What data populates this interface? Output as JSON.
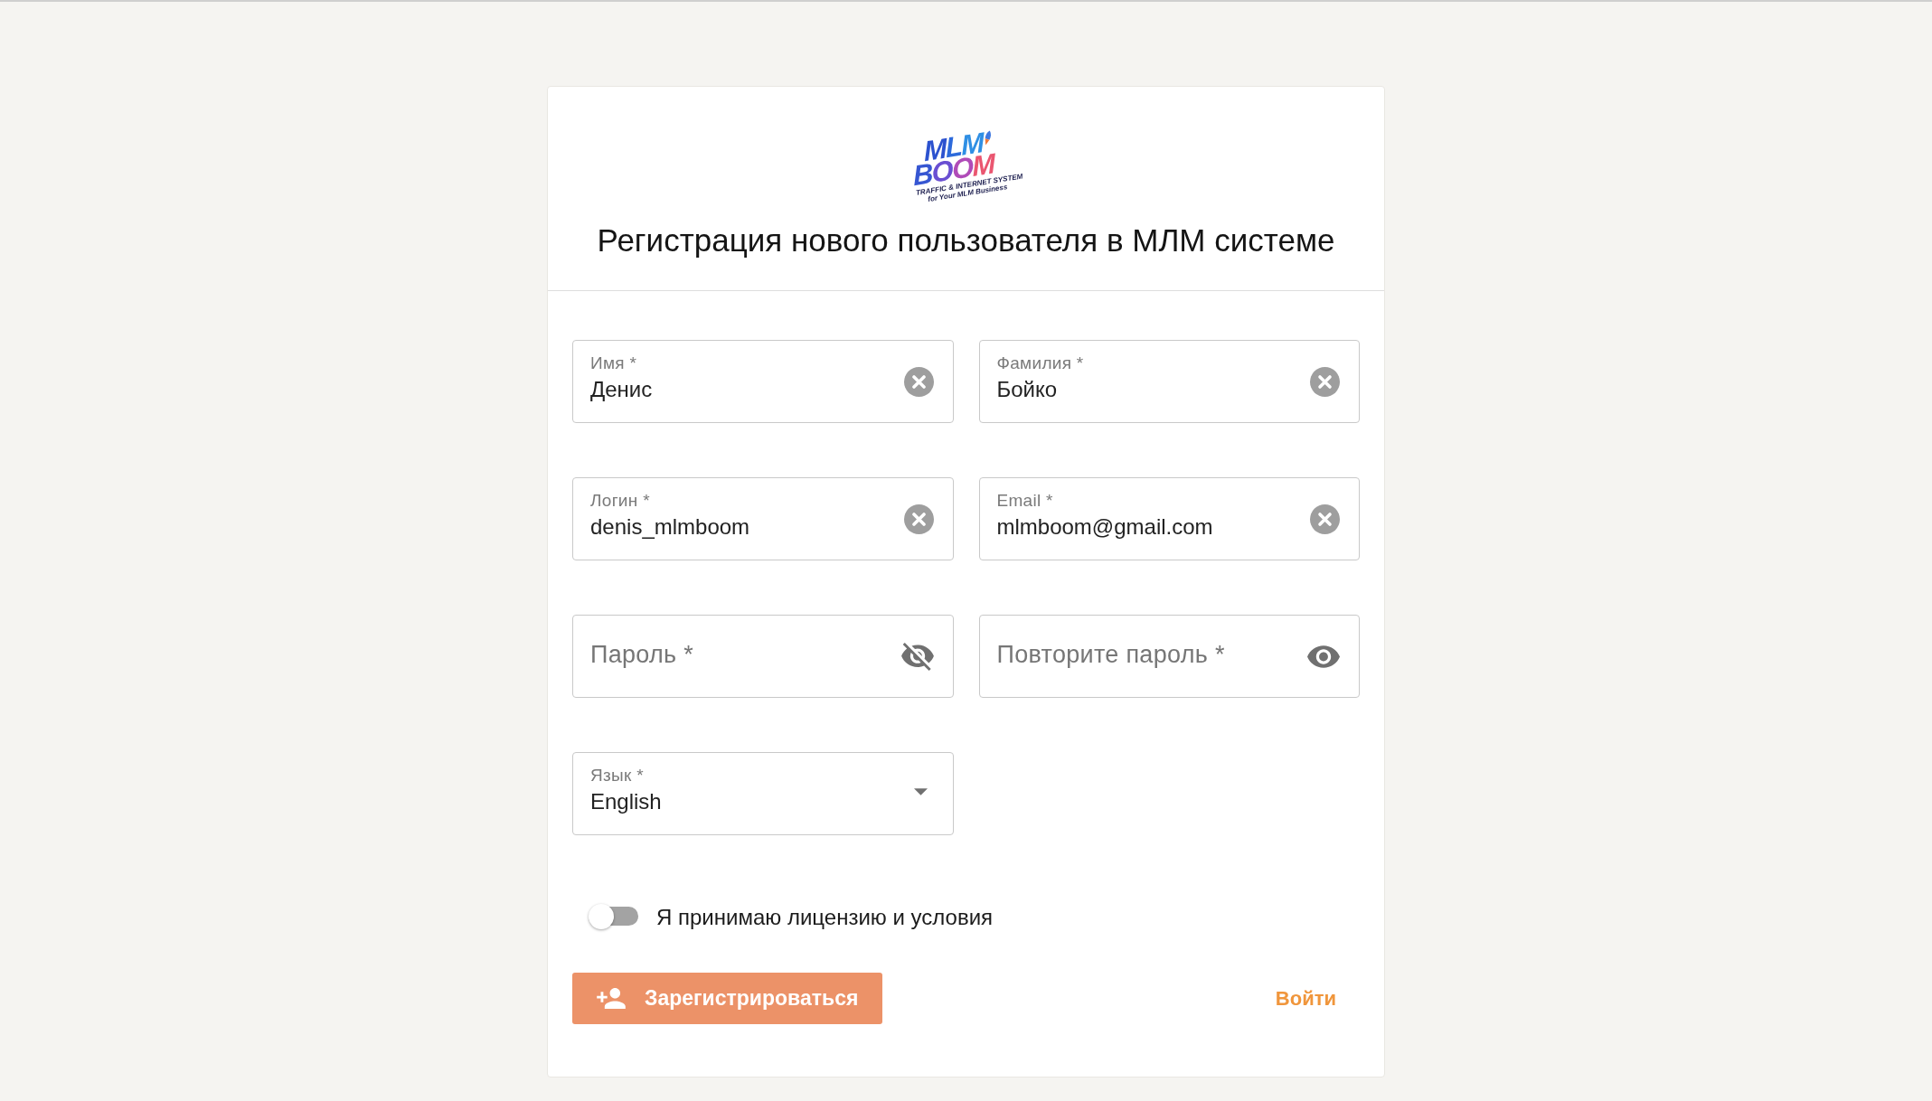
{
  "logo": {
    "wordmark_top": "MLM",
    "wordmark_bottom": "BOOM",
    "tagline": "TRAFFIC & INTERNET SYSTEM",
    "subtagline": "for Your MLM Business"
  },
  "title": "Регистрация нового пользователя в МЛМ системе",
  "fields": [
    {
      "kind": "text",
      "label": "Имя *",
      "value": "Денис"
    },
    {
      "kind": "text",
      "label": "Фамилия *",
      "value": "Бойко"
    },
    {
      "kind": "text",
      "label": "Логин *",
      "value": "denis_mlmboom"
    },
    {
      "kind": "text",
      "label": "Email *",
      "value": "mlmboom@gmail.com"
    },
    {
      "kind": "password",
      "placeholder": "Пароль *",
      "masked": true
    },
    {
      "kind": "password",
      "placeholder": "Повторите пароль *",
      "masked": false
    },
    {
      "kind": "select",
      "label": "Язык *",
      "value": "English"
    }
  ],
  "terms": {
    "label": "Я принимаю лицензию и условия",
    "on": false
  },
  "register_button": {
    "label": "Зарегистрироваться"
  },
  "login_link": {
    "label": "Войти"
  }
}
